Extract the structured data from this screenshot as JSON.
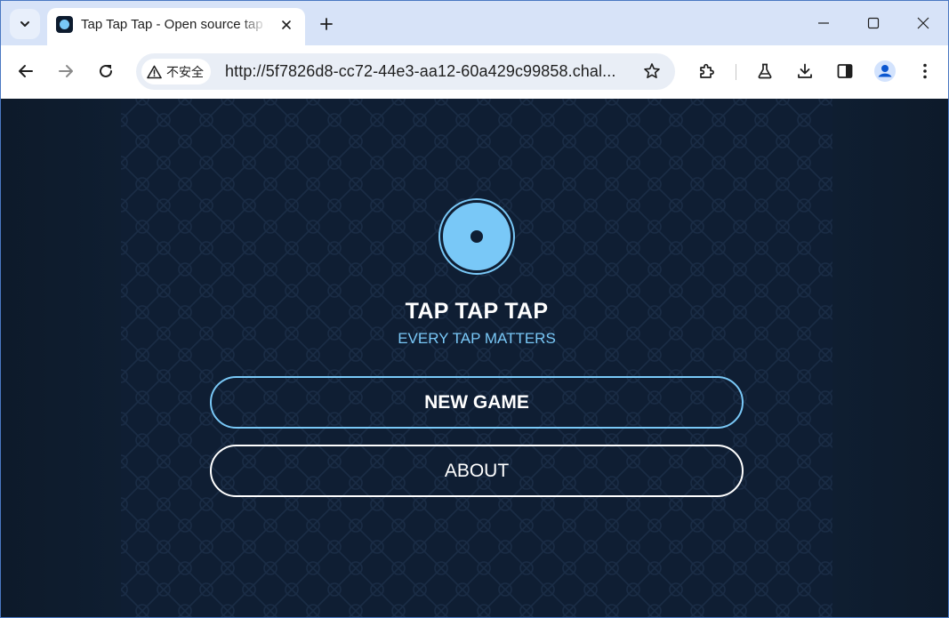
{
  "browser": {
    "tab": {
      "title": "Tap Tap Tap - Open source tap game"
    },
    "omnibox": {
      "security_label": "不安全",
      "url": "http://5f7826d8-cc72-44e3-aa12-60a429c99858.chal..."
    },
    "colors": {
      "tabstrip": "#d7e3f8",
      "toolbar": "#ffffff",
      "omnibox": "#e9eef6"
    }
  },
  "page": {
    "title": "TAP TAP TAP",
    "subtitle": "EVERY TAP MATTERS",
    "buttons": {
      "new_game": "NEW GAME",
      "about": "ABOUT"
    },
    "colors": {
      "background": "#0f1e33",
      "accent": "#79c8f7",
      "text": "#ffffff"
    }
  }
}
